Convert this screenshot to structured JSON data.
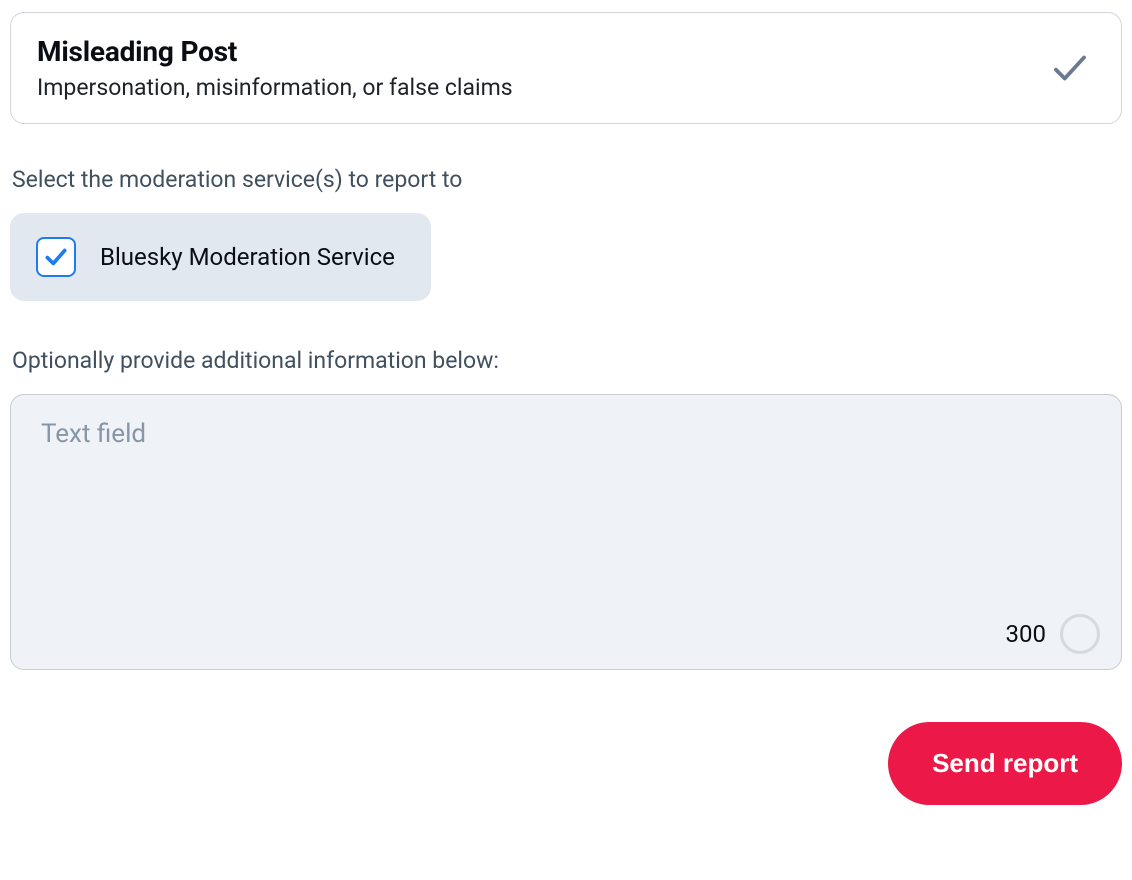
{
  "reason": {
    "title": "Misleading Post",
    "description": "Impersonation, misinformation, or false claims",
    "selected": true
  },
  "services": {
    "label": "Select the moderation service(s) to report to",
    "items": [
      {
        "name": "Bluesky Moderation Service",
        "checked": true
      }
    ]
  },
  "additional": {
    "label": "Optionally provide additional information below:",
    "placeholder": "Text field",
    "value": "",
    "remaining": "300"
  },
  "actions": {
    "send": "Send report"
  },
  "colors": {
    "accent_blue": "#1e7cf0",
    "danger_red": "#ec1847",
    "panel_gray": "#e2e8ef",
    "field_bg": "#eff2f6"
  }
}
